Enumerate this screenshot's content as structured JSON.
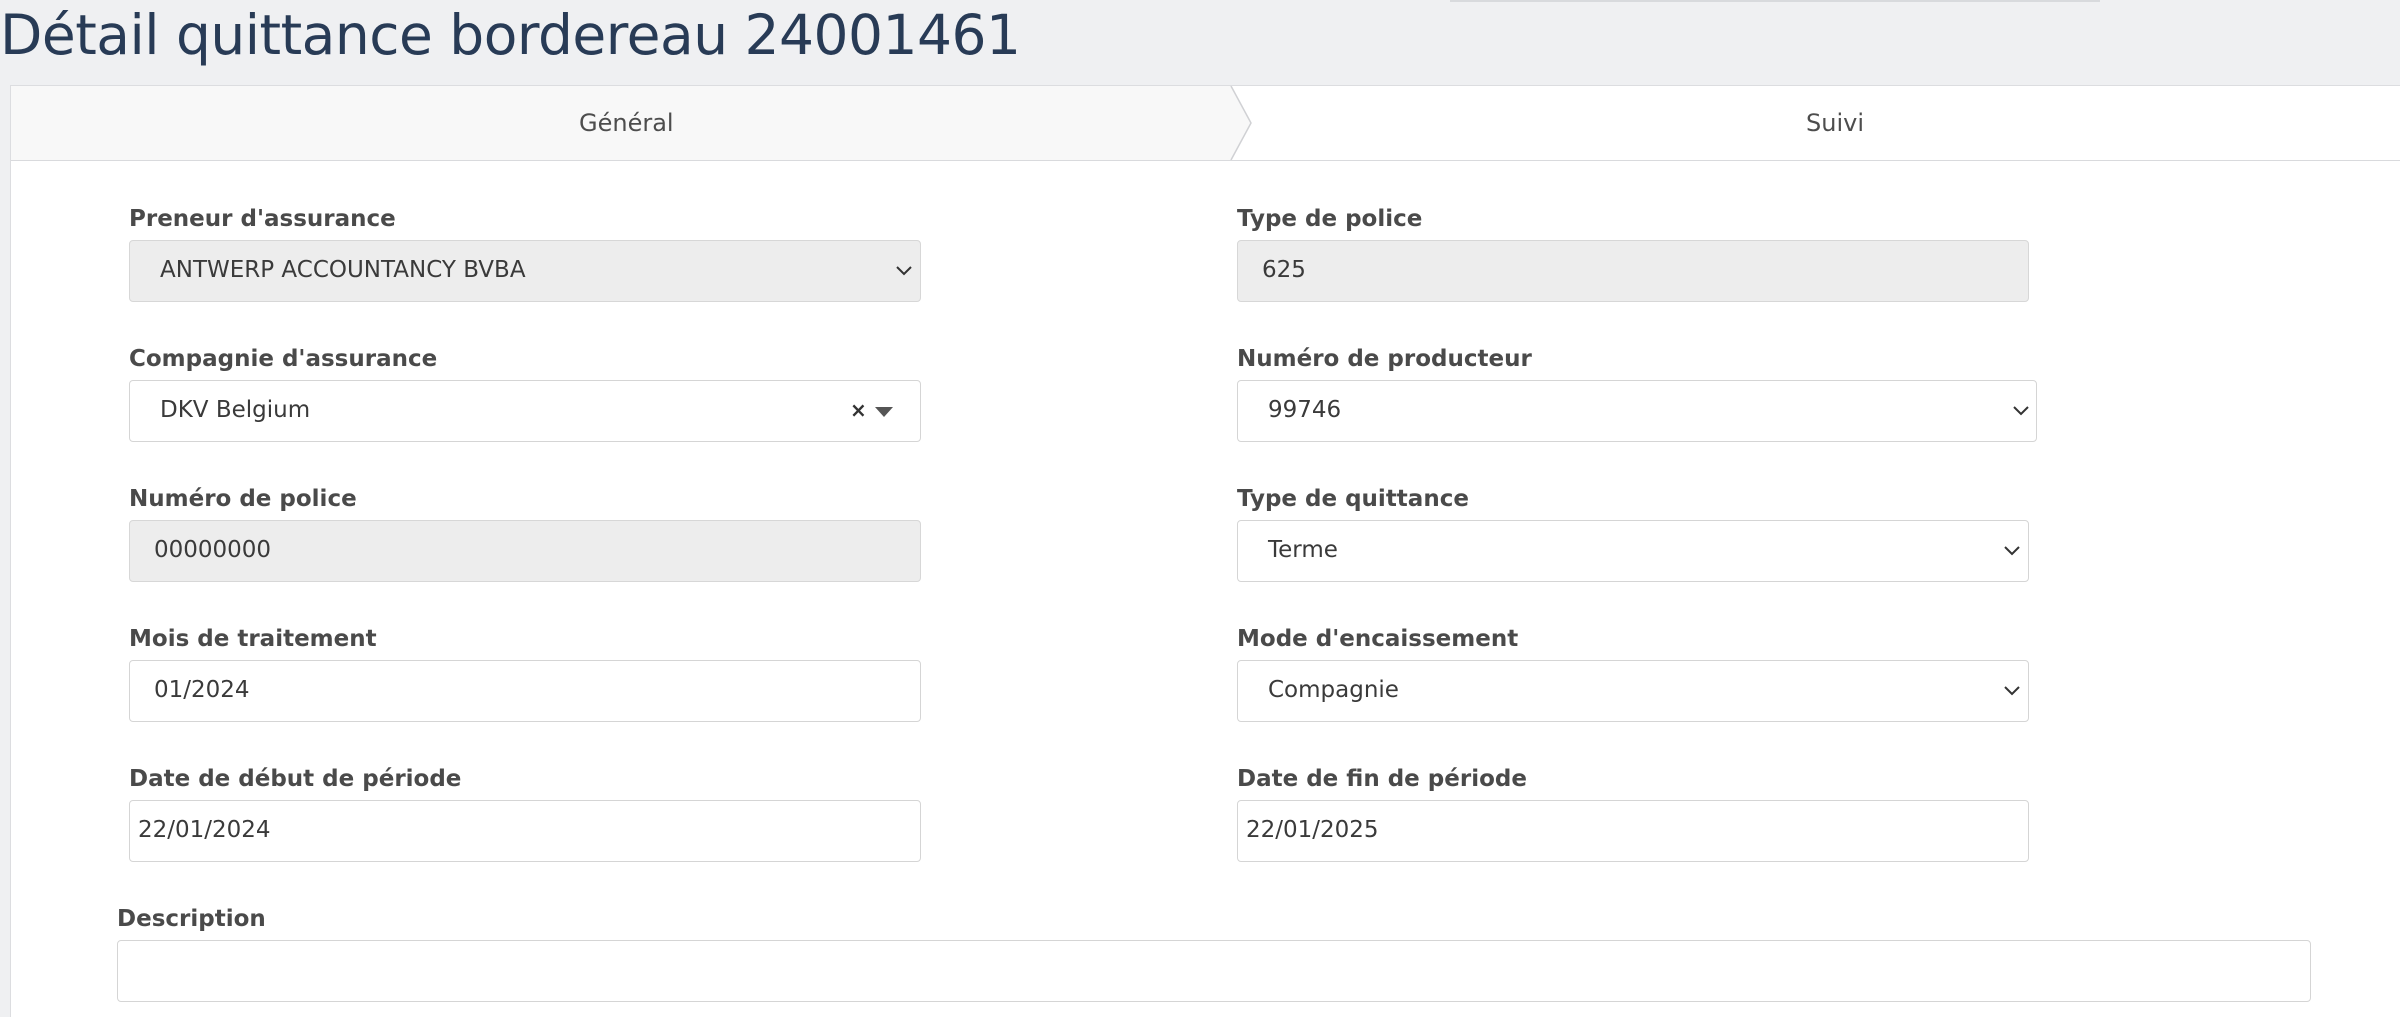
{
  "page": {
    "title": "Détail quittance bordereau 24001461"
  },
  "tabs": {
    "general": "Général",
    "suivi": "Suivi"
  },
  "form": {
    "preneur": {
      "label": "Preneur d'assurance",
      "value": "ANTWERP ACCOUNTANCY BVBA"
    },
    "type_police": {
      "label": "Type de police",
      "value": "625"
    },
    "compagnie": {
      "label": "Compagnie d'assurance",
      "value": "DKV Belgium",
      "clear": "×"
    },
    "numero_producteur": {
      "label": "Numéro de producteur",
      "value": "99746"
    },
    "numero_police": {
      "label": "Numéro de police",
      "value": "00000000"
    },
    "type_quittance": {
      "label": "Type de quittance",
      "value": "Terme"
    },
    "mois_traitement": {
      "label": "Mois de traitement",
      "value": "01/2024"
    },
    "mode_encaissement": {
      "label": "Mode d'encaissement",
      "value": "Compagnie"
    },
    "date_debut": {
      "label": "Date de début de période",
      "value": "22/01/2024"
    },
    "date_fin": {
      "label": "Date de fin de période",
      "value": "22/01/2025"
    },
    "description": {
      "label": "Description",
      "value": ""
    }
  },
  "icons": {
    "dropdown": "chevron-down-icon",
    "select2_arrow": "triangle-down-icon",
    "clear": "clear-icon"
  },
  "colors": {
    "title": "#283b56",
    "background": "#eff0f2",
    "readonly_field": "#ededed",
    "active_tab": "#f8f8f8"
  }
}
